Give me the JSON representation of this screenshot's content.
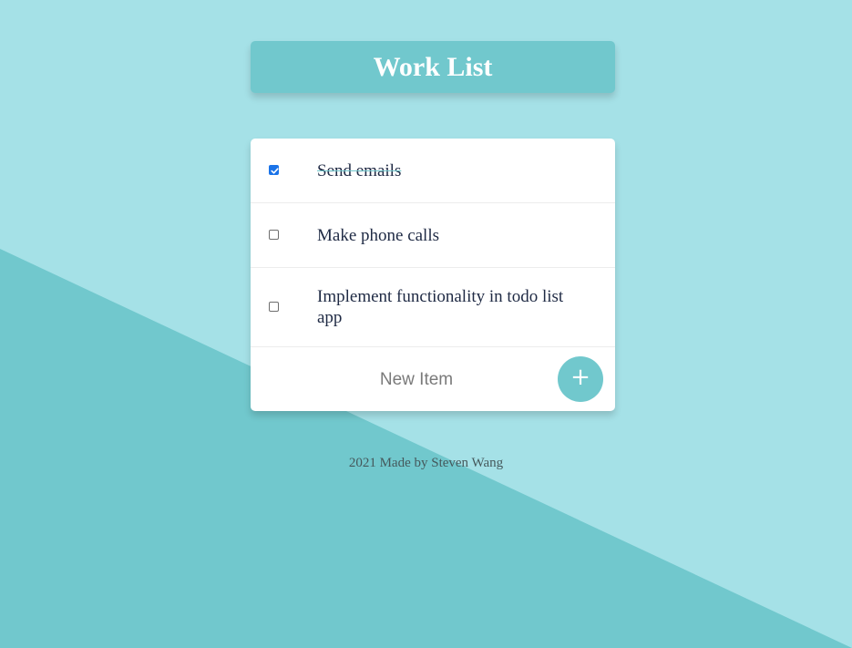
{
  "header": {
    "title": "Work List"
  },
  "todo": {
    "items": [
      {
        "label": "Send emails",
        "checked": true
      },
      {
        "label": "Make phone calls",
        "checked": false
      },
      {
        "label": "Implement functionality in todo list app",
        "checked": false
      }
    ],
    "new_item_placeholder": "New Item",
    "add_button_label": "+"
  },
  "footer": {
    "text": "2021 Made by Steven Wang"
  },
  "colors": {
    "background_light": "#a5e1e7",
    "background_dark": "#71c8cd",
    "accent": "#71c8cd",
    "checkbox_checked": "#1a73e8",
    "item_text": "#1f2a44"
  },
  "icons": {
    "add": "plus-icon",
    "checked": "checkmark-icon"
  }
}
